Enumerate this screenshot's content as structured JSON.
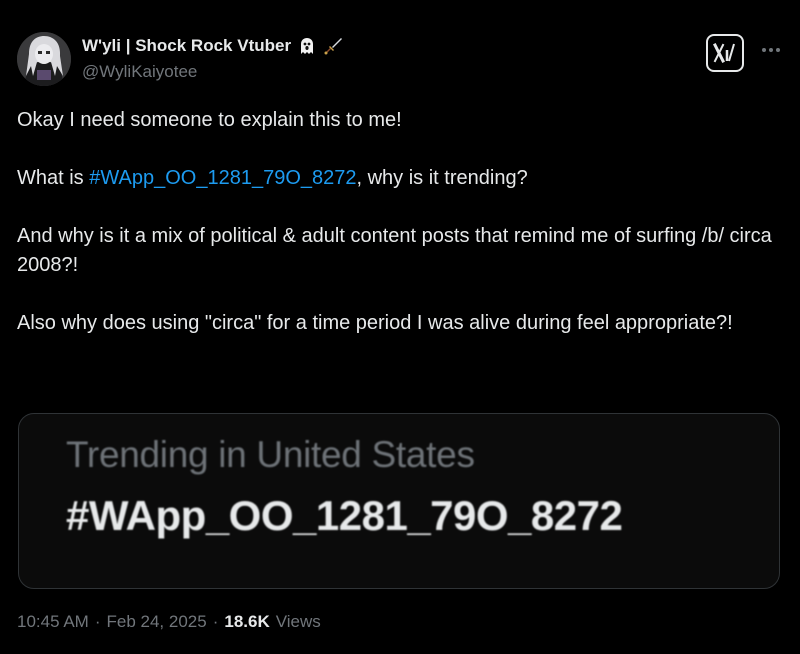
{
  "tweet": {
    "author": {
      "display_name": "W'yli | Shock Rock Vtuber",
      "handle": "@WyliKaiyotee",
      "name_emojis": [
        "ghost-emoji",
        "dagger-emoji"
      ]
    },
    "actions": {
      "grok_icon": "x-grok-logo-icon",
      "more_icon": "more-dots-icon"
    },
    "body": {
      "p1": "Okay I need someone to explain this to me!",
      "p2_prefix": "What is ",
      "p2_hashtag": "#WApp_OO_1281_79O_8272",
      "p2_suffix": ", why is it trending?",
      "p3": "And why is it a mix of political & adult content posts that remind me of surfing /b/ circa 2008?!",
      "p4": "Also why does using \"circa\" for a time period I was alive during feel appropriate?!"
    },
    "card": {
      "label": "Trending in United States",
      "trend": "#WApp_OO_1281_79O_8272"
    },
    "meta": {
      "time": "10:45 AM",
      "sep1": "·",
      "date": "Feb 24, 2025",
      "sep2": "·",
      "views_count": "18.6K",
      "views_label": "Views"
    },
    "colors": {
      "background": "#000000",
      "text": "#e7e9ea",
      "secondary": "#71767b",
      "link": "#1d9bf0",
      "border": "#2f3336"
    }
  }
}
